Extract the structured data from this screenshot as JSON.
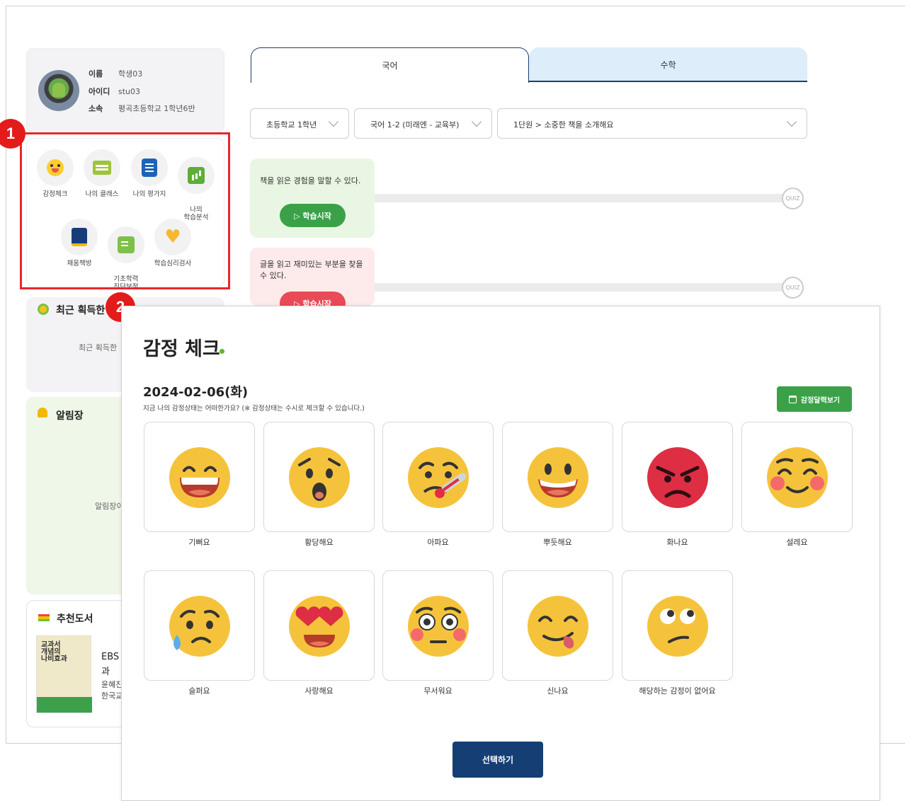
{
  "profile": {
    "name_label": "이름",
    "name_value": "학생03",
    "id_label": "아이디",
    "id_value": "stu03",
    "org_label": "소속",
    "org_value": "평곡초등학교 1학년6반"
  },
  "menu": {
    "items": [
      {
        "label": "감정체크",
        "icon": "smile-icon"
      },
      {
        "label": "나의 클래스",
        "icon": "class-card-icon"
      },
      {
        "label": "나의 평가지",
        "icon": "document-icon"
      },
      {
        "label": "나의\n학습분석",
        "icon": "chart-icon"
      },
      {
        "label": "채움책방",
        "icon": "book-icon"
      },
      {
        "label": "기초학력\n진단보정",
        "icon": "pencil-note-icon"
      },
      {
        "label": "학습심리검사",
        "icon": "heart-icon"
      }
    ]
  },
  "badges": {
    "one": "1",
    "two": "2"
  },
  "left": {
    "recent_title": "최근 획득한",
    "recent_empty": "최근 획득한",
    "notice_title": "알림장",
    "notice_empty": "알림장이",
    "books_title": "추천도서",
    "book_cover_title": "교과서 개념의 나비효과",
    "book_line1": "EBS",
    "book_line2": "과",
    "book_line3": "윤혜진",
    "book_line4": "한국교"
  },
  "tabs": {
    "korean": "국어",
    "math": "수학"
  },
  "dropdowns": {
    "grade": "초등학교 1학년",
    "book": "국어 1-2 (미래엔 - 교육부)",
    "unit": "1단원 > 소중한 책을 소개해요"
  },
  "lessons": [
    {
      "text": "책을 읽은 경험을 말할 수 있다.",
      "button": "▷ 학습시작"
    },
    {
      "text": "글을 읽고 재미있는 부분을 찾을 수 있다.",
      "button": "▷ 학습시작"
    }
  ],
  "quiz_label": "QUIZ",
  "modal": {
    "title": "감정 체크",
    "date": "2024-02-06(화)",
    "hint": "지금 나의 감정상태는 어떠한가요? (※ 감정상태는 수시로 체크할 수 있습니다.)",
    "history_button": "감정달력보기",
    "select_button": "선택하기",
    "emotions": [
      "기뻐요",
      "황당해요",
      "아파요",
      "뿌듯해요",
      "화나요",
      "설레요",
      "슬퍼요",
      "사랑해요",
      "무서워요",
      "신나요",
      "해당하는 감정이 없어요"
    ]
  },
  "colors": {
    "accent_navy": "#153e74",
    "green": "#3ba148",
    "red_marker": "#e31b1b",
    "emoji_yellow": "#f5c33b"
  }
}
